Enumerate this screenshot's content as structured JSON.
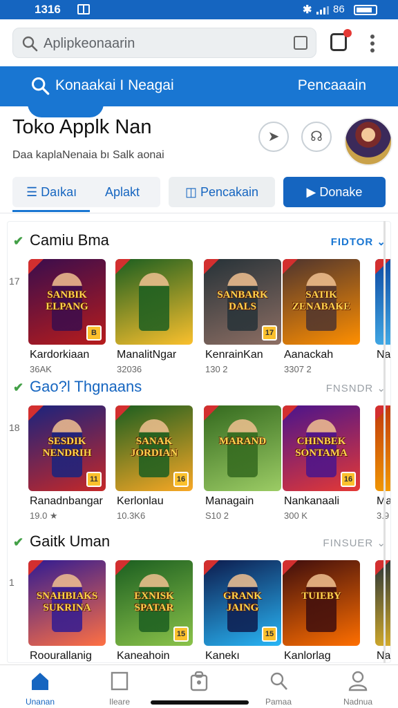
{
  "status": {
    "time": "1316",
    "battery": "86"
  },
  "search": {
    "placeholder": "Aplipkeonaarin"
  },
  "banner": {
    "title": "Konaakai I Neagai",
    "right_link": "Pencaaain"
  },
  "app": {
    "title": "Toko Applk Nan",
    "subtitle": "Daa kaplaNenaia bı Salk aonai"
  },
  "tabs": {
    "tab1_a": "Daıkaı",
    "tab1_b": "Aplakt",
    "tab2": "Pencakain",
    "tab3": "Donake"
  },
  "sections": [
    {
      "title": "Camiu Bma",
      "link": "FIDTOR",
      "rownum": "17",
      "items": [
        {
          "name": "Kardorkiaan",
          "meta": "36AK",
          "art": "SANBIK ELPANG",
          "badge": "B",
          "c1": "#3a0d4d",
          "c2": "#b71c1c"
        },
        {
          "name": "ManalitNgar",
          "meta": "32036",
          "art": "",
          "badge": "",
          "c1": "#1b5e20",
          "c2": "#fbc02d"
        },
        {
          "name": "KenrainKan",
          "meta": "130 2",
          "art": "SANBARK DALS",
          "badge": "17",
          "c1": "#263238",
          "c2": "#8d6e63"
        },
        {
          "name": "Aanackah",
          "meta": "3307 2",
          "art": "SATIK ZENABAKE",
          "badge": "",
          "c1": "#4e342e",
          "c2": "#ff8f00"
        },
        {
          "name": "Na",
          "meta": "",
          "art": "",
          "badge": "",
          "c1": "#0d47a1",
          "c2": "#4fc3f7"
        }
      ]
    },
    {
      "title": "Gao?l Thgnaans",
      "link": "FNSNDR",
      "rownum": "18",
      "items": [
        {
          "name": "Ranadnbangar",
          "meta": "19.0 ★",
          "art": "SESDIK NENDRIH",
          "badge": "11",
          "c1": "#1a237e",
          "c2": "#c62828"
        },
        {
          "name": "Kerlonlau",
          "meta": "10.3K6",
          "art": "SANAK JORDIAN",
          "badge": "16",
          "c1": "#1b5e20",
          "c2": "#f9a825"
        },
        {
          "name": "Managain",
          "meta": "S10 2",
          "art": "MARAND",
          "badge": "",
          "c1": "#33691e",
          "c2": "#9ccc65"
        },
        {
          "name": "Nankanaali",
          "meta": "300 K",
          "art": "CHINBEK SONTAMA",
          "badge": "16",
          "c1": "#4a148c",
          "c2": "#e53935"
        },
        {
          "name": "Mar",
          "meta": "3.9",
          "art": "",
          "badge": "",
          "c1": "#bf360c",
          "c2": "#ffb300"
        }
      ]
    },
    {
      "title": "Gaitk Uman",
      "link": "FINSUER",
      "rownum": "1",
      "items": [
        {
          "name": "Roourallanig",
          "meta": "",
          "art": "SNAHBIAKS SUKRINA",
          "badge": "",
          "c1": "#311b92",
          "c2": "#ff7043"
        },
        {
          "name": "Kaneahoin",
          "meta": "",
          "art": "EXNISK SPATAR",
          "badge": "15",
          "c1": "#1b5e20",
          "c2": "#8bc34a"
        },
        {
          "name": "Kanekı",
          "meta": "",
          "art": "GRANK JAING",
          "badge": "15",
          "c1": "#0d1b4d",
          "c2": "#29b6f6"
        },
        {
          "name": "Kanlorlag",
          "meta": "",
          "art": "TUIEBY",
          "badge": "",
          "c1": "#3e0d0d",
          "c2": "#ff6f00"
        },
        {
          "name": "Na",
          "meta": "",
          "art": "",
          "badge": "",
          "c1": "#263238",
          "c2": "#ffca28"
        }
      ]
    }
  ],
  "nav": [
    {
      "label": "Unanan",
      "icon": "home-icon"
    },
    {
      "label": "Ileare",
      "icon": "apps-icon"
    },
    {
      "label": "",
      "icon": "bag-icon"
    },
    {
      "label": "Pamaa",
      "icon": "search-icon"
    },
    {
      "label": "Nadnua",
      "icon": "profile-icon"
    }
  ],
  "colors": {
    "primary": "#1976d2",
    "primary_dark": "#1565c0",
    "check": "#43a047"
  }
}
